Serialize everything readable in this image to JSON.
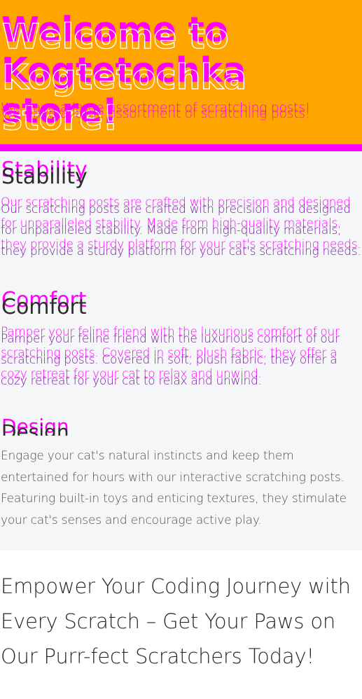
{
  "hero": {
    "title": "Welcome to Kogtetochka store!",
    "subtitle": "We have a large assortment of scratching posts!"
  },
  "features": [
    {
      "title": "Stability",
      "text": "Our scratching posts are crafted with precision and designed for unparalleled stability. Made from high-quality materials, they provide a sturdy platform for your cat's scratching needs."
    },
    {
      "title": "Comfort",
      "text": "Pamper your feline friend with the luxurious comfort of our scratching posts. Covered in soft, plush fabric, they offer a cozy retreat for your cat to relax and unwind."
    },
    {
      "title": "Design",
      "text": "Engage your cat's natural instincts and keep them entertained for hours with our interactive scratching posts. Featuring built-in toys and enticing textures, they stimulate your cat's senses and encourage active play."
    }
  ],
  "tagline": "Empower Your Coding Journey with Every Scratch – Get Your Paws on Our Purr-fect Scratchers Today!",
  "colors": {
    "hero_background": "#ffa500",
    "accent_magenta": "#ff00ff",
    "panel_background": "#f5f6f8"
  }
}
